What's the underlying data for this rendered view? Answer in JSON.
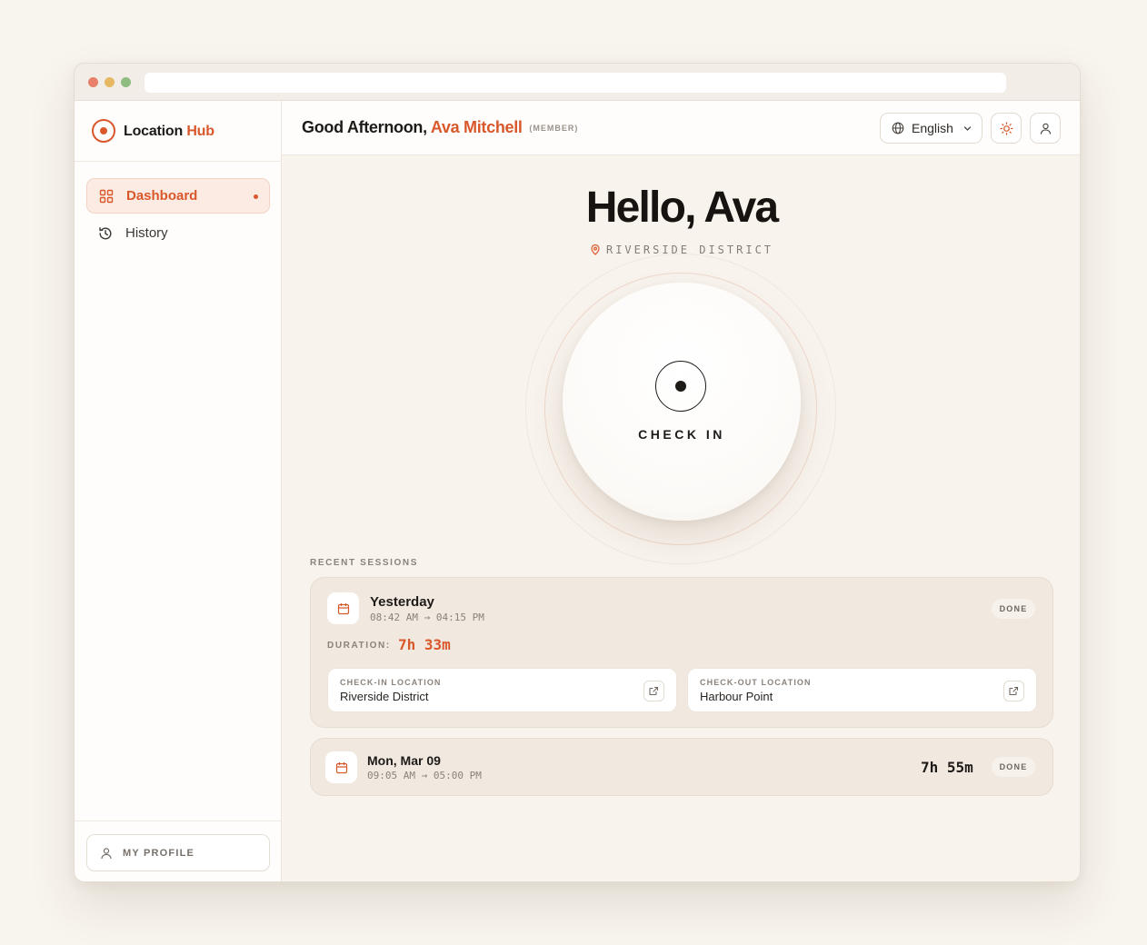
{
  "brand": {
    "name": "Location",
    "accent": "Hub"
  },
  "sidebar": {
    "items": [
      {
        "label": "Dashboard",
        "icon": "grid-icon",
        "active": true
      },
      {
        "label": "History",
        "icon": "history-icon",
        "active": false
      }
    ],
    "profile_label": "MY PROFILE"
  },
  "header": {
    "greeting": "Good Afternoon,",
    "user_name": "Ava Mitchell",
    "role": "(MEMBER)",
    "language": "English"
  },
  "hero": {
    "title": "Hello, Ava",
    "location": "RIVERSIDE DISTRICT",
    "checkin_label": "CHECK IN"
  },
  "sessions": {
    "section_label": "RECENT SESSIONS",
    "items": [
      {
        "title": "Yesterday",
        "time": "08:42 AM → 04:15 PM",
        "status": "DONE",
        "duration_label": "DURATION:",
        "duration": "7h 33m",
        "checkin_label": "CHECK-IN LOCATION",
        "checkin_location": "Riverside District",
        "checkout_label": "CHECK-OUT LOCATION",
        "checkout_location": "Harbour Point"
      },
      {
        "title": "Mon, Mar 09",
        "time": "09:05 AM → 05:00 PM",
        "status": "DONE",
        "duration": "7h 55m"
      }
    ]
  },
  "colors": {
    "accent": "#d9582b",
    "background": "#f8f4ee",
    "card": "#f1e9df"
  }
}
